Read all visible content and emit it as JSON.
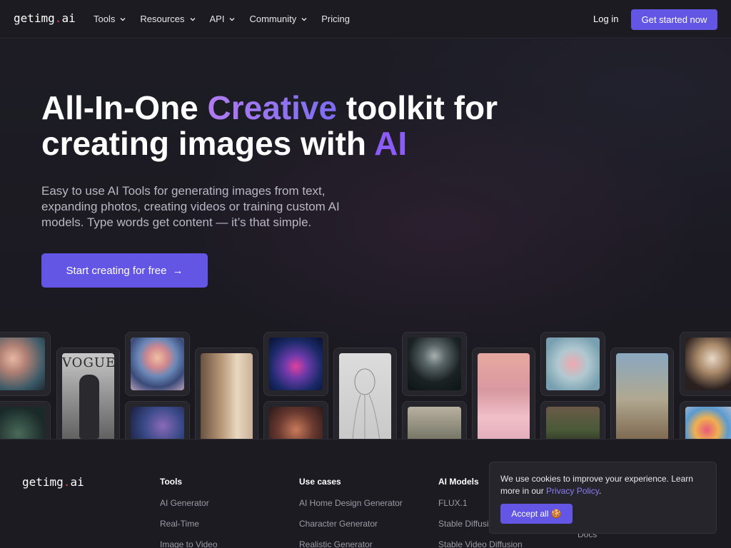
{
  "header": {
    "logo_main": "getimg",
    "logo_dot": ".",
    "logo_tld": "ai",
    "nav": [
      {
        "label": "Tools",
        "has_dropdown": true
      },
      {
        "label": "Resources",
        "has_dropdown": true
      },
      {
        "label": "API",
        "has_dropdown": true
      },
      {
        "label": "Community",
        "has_dropdown": true
      },
      {
        "label": "Pricing",
        "has_dropdown": false
      }
    ],
    "login_label": "Log in",
    "cta_label": "Get started now"
  },
  "hero": {
    "title_part1": "All-In-One ",
    "title_highlight1": "Creative",
    "title_part2": " toolkit for creating images with ",
    "title_highlight2": "AI",
    "subtitle": "Easy to use AI Tools for generating images from text, expanding photos, creating videos or training custom AI models. Type words get content — it’s that simple.",
    "cta_label": "Start creating for free",
    "cta_arrow": "→"
  },
  "gallery": {
    "vogue_text": "VOGUE"
  },
  "footer": {
    "logo_main": "getimg",
    "logo_dot": ".",
    "logo_tld": "ai",
    "columns": [
      {
        "title": "Tools",
        "links": [
          "AI Generator",
          "Real-Time",
          "Image to Video"
        ]
      },
      {
        "title": "Use cases",
        "links": [
          "AI Home Design Generator",
          "Character Generator",
          "Realistic Generator"
        ]
      },
      {
        "title": "AI Models",
        "links": [
          "FLUX.1",
          "Stable Diffusion",
          "Stable Video Diffusion"
        ]
      },
      {
        "title": "",
        "links": [
          "",
          "",
          "Docs"
        ]
      }
    ]
  },
  "cookie": {
    "text_before_link": "We use cookies to improve your experience. Learn more in our ",
    "link_label": "Privacy Policy",
    "text_after_link": ".",
    "accept_label": "Accept all 🍪"
  },
  "colors": {
    "accent": "#6356e5",
    "highlight_purple": "#8b5cf6",
    "background": "#1b1a20",
    "logo_dot": "#ef4444"
  }
}
